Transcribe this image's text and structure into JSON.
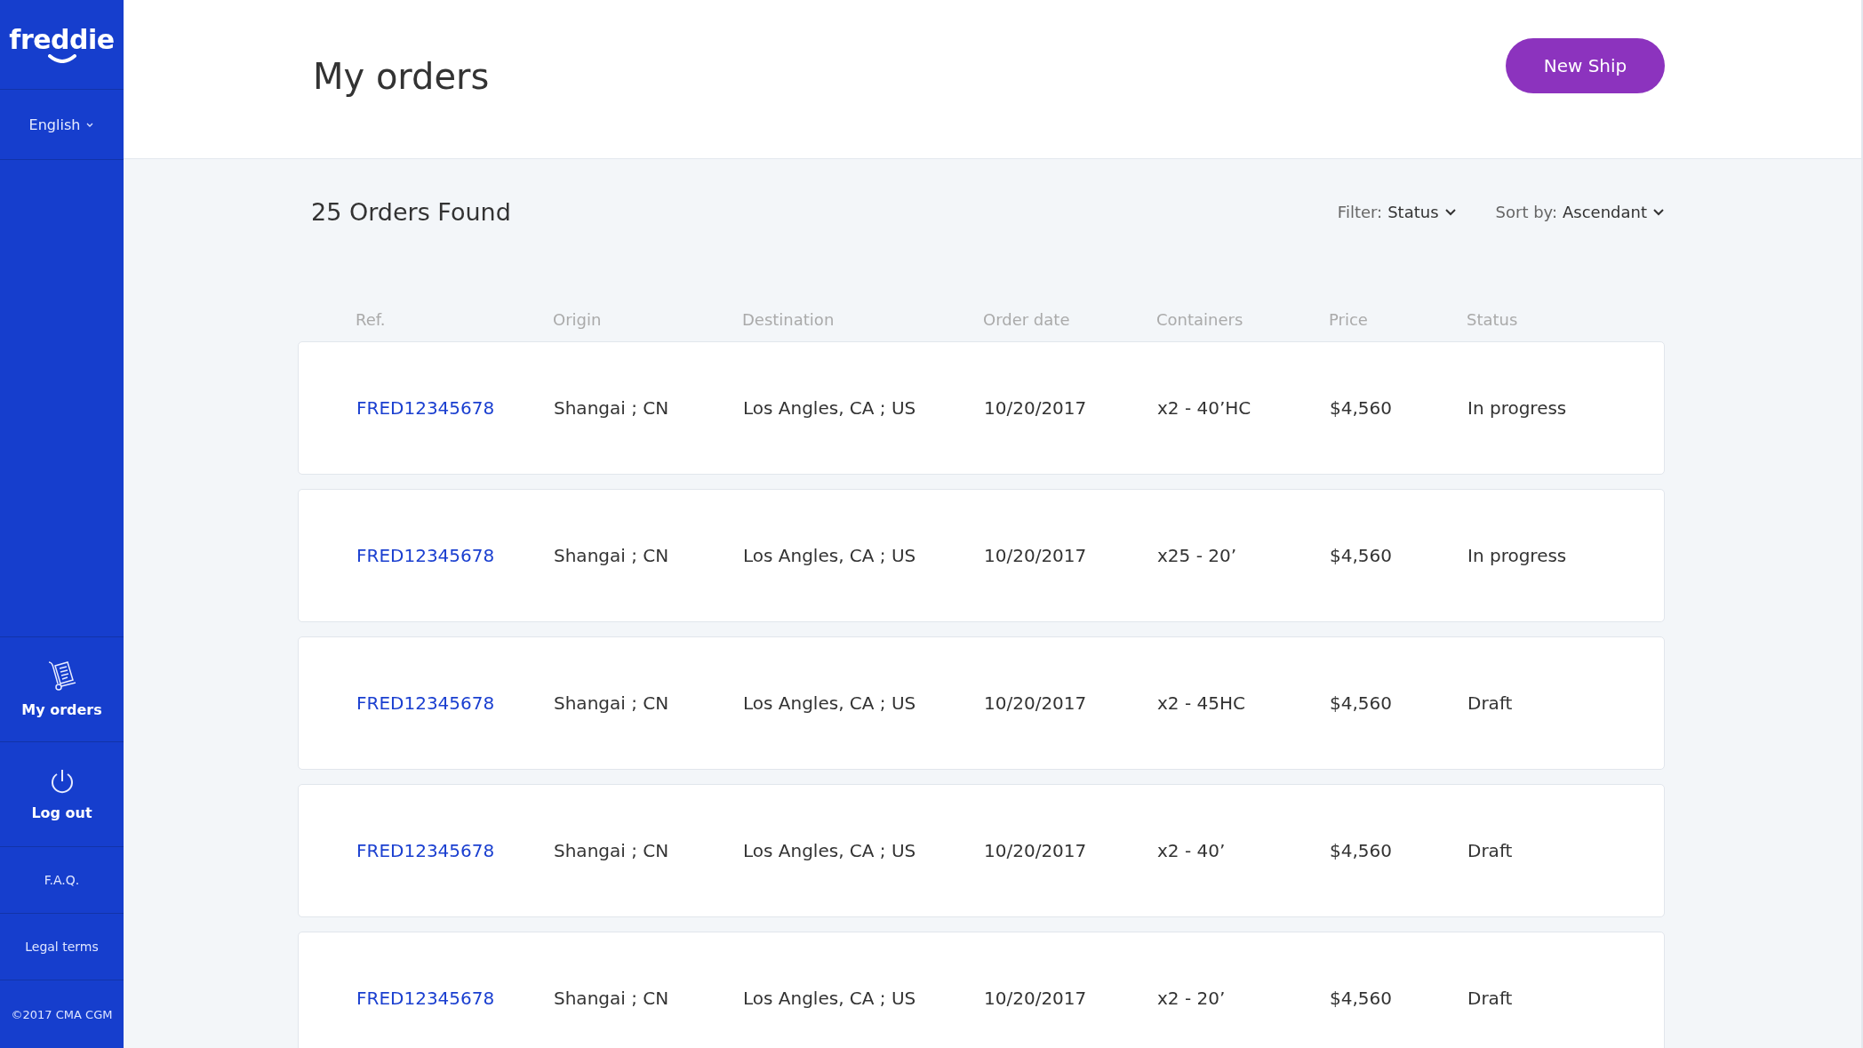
{
  "sidebar": {
    "logo": "freddie",
    "language": "English",
    "nav": [
      {
        "kind": "orders",
        "label": "My orders"
      },
      {
        "kind": "logout",
        "label": "Log out"
      }
    ],
    "links": [
      "F.A.Q.",
      "Legal terms"
    ],
    "copyright": "©2017 CMA CGM"
  },
  "header": {
    "title": "My orders",
    "button": "New Ship"
  },
  "summary": "25 Orders Found",
  "filter": {
    "label": "Filter:",
    "value": "Status"
  },
  "sort": {
    "label": "Sort by:",
    "value": "Ascendant"
  },
  "table": {
    "columns": [
      "Ref.",
      "Origin",
      "Destination",
      "Order date",
      "Containers",
      "Price",
      "Status"
    ],
    "rows": [
      [
        "FRED12345678",
        "Shangai ; CN",
        "Los Angles, CA ; US",
        "10/20/2017",
        "x2 - 40’HC",
        "$4,560",
        "In progress"
      ],
      [
        "FRED12345678",
        "Shangai ; CN",
        "Los Angles, CA ; US",
        "10/20/2017",
        "x25 - 20’",
        "$4,560",
        "In progress"
      ],
      [
        "FRED12345678",
        "Shangai ; CN",
        "Los Angles, CA ; US",
        "10/20/2017",
        "x2 - 45HC",
        "$4,560",
        "Draft"
      ],
      [
        "FRED12345678",
        "Shangai ; CN",
        "Los Angles, CA ; US",
        "10/20/2017",
        "x2 - 40’",
        "$4,560",
        "Draft"
      ],
      [
        "FRED12345678",
        "Shangai ; CN",
        "Los Angles, CA ; US",
        "10/20/2017",
        "x2 - 20’",
        "$4,560",
        "Draft"
      ]
    ]
  }
}
